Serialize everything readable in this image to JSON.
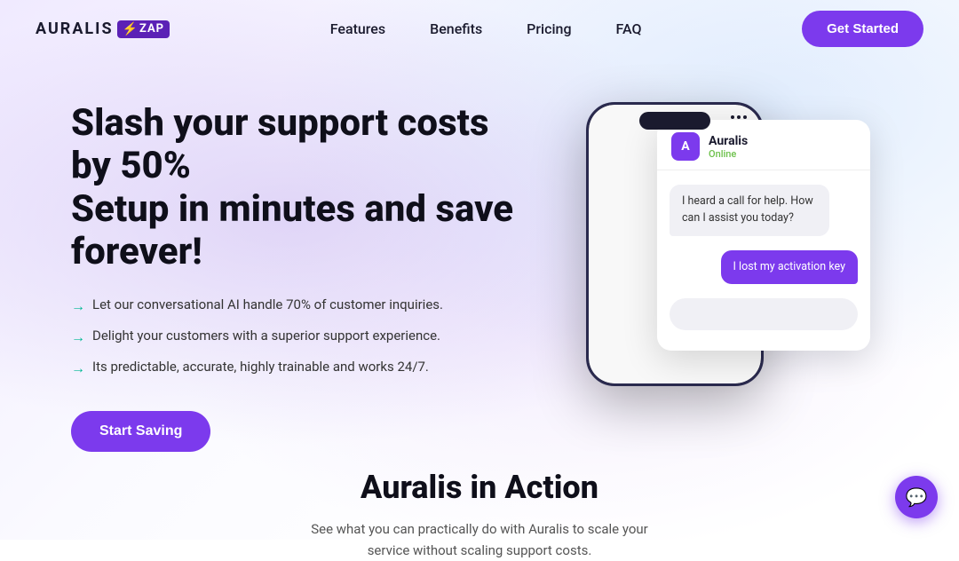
{
  "nav": {
    "logo_text": "AURALIS",
    "logo_zap": "ZAP",
    "links": [
      {
        "label": "Features",
        "id": "features"
      },
      {
        "label": "Benefits",
        "id": "benefits"
      },
      {
        "label": "Pricing",
        "id": "pricing"
      },
      {
        "label": "FAQ",
        "id": "faq"
      }
    ],
    "cta_label": "Get Started"
  },
  "hero": {
    "title_line1": "Slash your support costs by 50%",
    "title_line2": "Setup in minutes and save forever!",
    "bullets": [
      "Let our conversational AI handle 70% of customer inquiries.",
      "Delight your customers with a superior support experience.",
      "Its predictable, accurate, highly trainable and works 24/7."
    ],
    "cta_label": "Start Saving"
  },
  "chat": {
    "bot_name": "Auralis",
    "bot_status": "Online",
    "bot_avatar_letter": "A",
    "bot_message": "I heard a call for help. How can I assist you today?",
    "user_message": "I lost my activation key"
  },
  "bottom": {
    "title": "Auralis in Action",
    "subtitle": "See what you can practically do with Auralis to scale your service without scaling support costs."
  },
  "fab": {
    "icon": "💬"
  },
  "colors": {
    "accent": "#7c3aed",
    "green": "#00b894",
    "dark": "#0f0f1a"
  }
}
